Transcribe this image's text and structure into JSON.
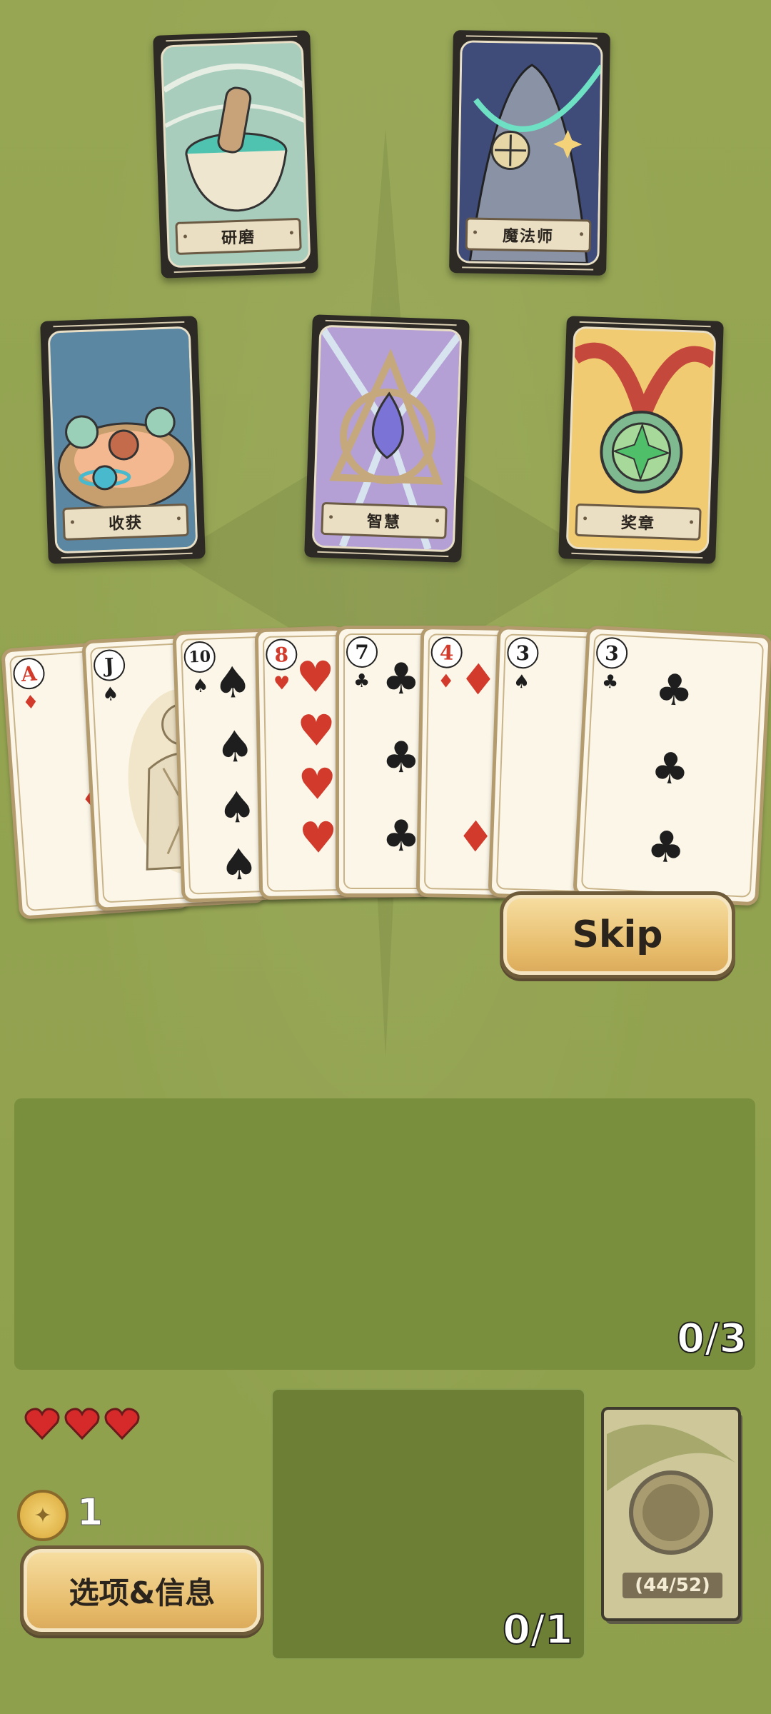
{
  "tarot_cards": [
    {
      "label": "研磨",
      "icon": "mortar-pestle-icon"
    },
    {
      "label": "魔法师",
      "icon": "wizard-icon"
    },
    {
      "label": "收获",
      "icon": "planets-nest-icon"
    },
    {
      "label": "智慧",
      "icon": "triangle-drop-icon"
    },
    {
      "label": "奖章",
      "icon": "medal-icon"
    }
  ],
  "hand": [
    {
      "rank": "A",
      "suit": "♦",
      "color": "red"
    },
    {
      "rank": "J",
      "suit": "♠",
      "color": "black"
    },
    {
      "rank": "10",
      "suit": "♠",
      "color": "black"
    },
    {
      "rank": "8",
      "suit": "♥",
      "color": "red"
    },
    {
      "rank": "7",
      "suit": "♣",
      "color": "black"
    },
    {
      "rank": "4",
      "suit": "♦",
      "color": "red"
    },
    {
      "rank": "3",
      "suit": "♠",
      "color": "black"
    },
    {
      "rank": "3",
      "suit": "♣",
      "color": "black"
    }
  ],
  "controls": {
    "skip_label": "Skip",
    "options_label": "选项&信息"
  },
  "play_area": {
    "counter": "0/3"
  },
  "discard_area": {
    "counter": "0/1"
  },
  "player": {
    "hearts": 3,
    "coins": "1"
  },
  "deck": {
    "count_label": "(44/52)"
  },
  "colors": {
    "background": "#93a451",
    "panel": "#7a8f3d",
    "button": "#e6bb6a",
    "heart": "#d62a2a"
  }
}
